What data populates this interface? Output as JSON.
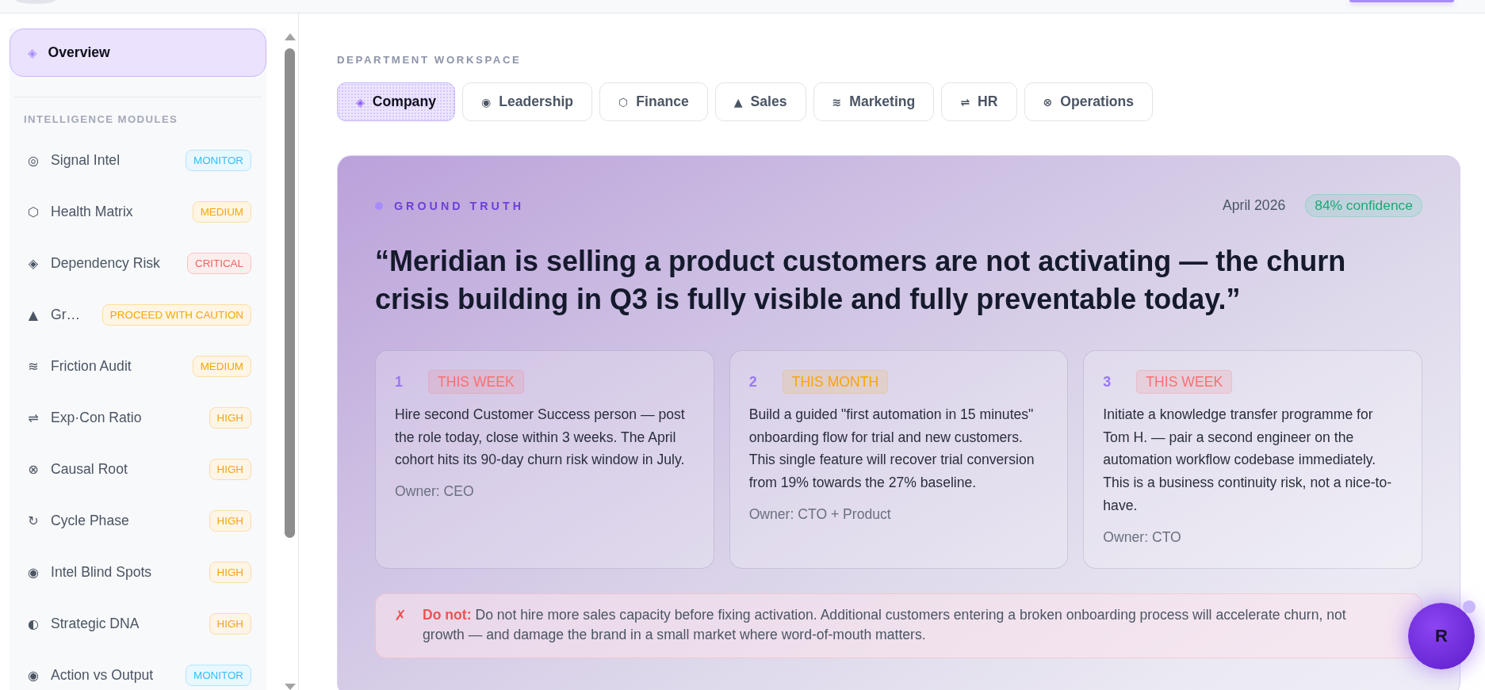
{
  "sidebar": {
    "overview": {
      "icon": "◈",
      "label": "Overview",
      "selected": true
    },
    "section_title": "INTELLIGENCE MODULES",
    "items": [
      {
        "icon": "◎",
        "label": "Signal Intel",
        "selected": false,
        "badge": {
          "text": "MONITOR",
          "color": "#38bdf8"
        }
      },
      {
        "icon": "⬡",
        "label": "Health Matrix",
        "selected": false,
        "badge": {
          "text": "MEDIUM",
          "color": "#f5a70b"
        }
      },
      {
        "icon": "◈",
        "label": "Dependency Risk",
        "selected": false,
        "badge": {
          "text": "CRITICAL",
          "color": "#ef6461"
        }
      },
      {
        "icon": "▲",
        "label": "Gr…",
        "selected": false,
        "badge": {
          "text": "PROCEED WITH CAUTION",
          "color": "#f5a70b"
        }
      },
      {
        "icon": "≋",
        "label": "Friction Audit",
        "selected": false,
        "badge": {
          "text": "MEDIUM",
          "color": "#f5a70b"
        }
      },
      {
        "icon": "⇌",
        "label": "Exp·Con Ratio",
        "selected": false,
        "badge": {
          "text": "HIGH",
          "color": "#f7a21b"
        }
      },
      {
        "icon": "⊗",
        "label": "Causal Root",
        "selected": false,
        "badge": {
          "text": "HIGH",
          "color": "#f7a21b"
        }
      },
      {
        "icon": "↻",
        "label": "Cycle Phase",
        "selected": false,
        "badge": {
          "text": "HIGH",
          "color": "#f7a21b"
        }
      },
      {
        "icon": "◉",
        "label": "Intel Blind Spots",
        "selected": false,
        "badge": {
          "text": "HIGH",
          "color": "#f7a21b"
        }
      },
      {
        "icon": "◐",
        "label": "Strategic DNA",
        "selected": false,
        "badge": {
          "text": "HIGH",
          "color": "#f7a21b"
        }
      },
      {
        "icon": "◉",
        "label": "Action vs Output",
        "selected": false,
        "badge": {
          "text": "MONITOR",
          "color": "#38bdf8"
        }
      }
    ]
  },
  "department_label": "DEPARTMENT WORKSPACE",
  "tabs": [
    {
      "icon": "◈",
      "label": "Company",
      "selected": true
    },
    {
      "icon": "◉",
      "label": "Leadership",
      "selected": false
    },
    {
      "icon": "⬡",
      "label": "Finance",
      "selected": false
    },
    {
      "icon": "▲",
      "label": "Sales",
      "selected": false
    },
    {
      "icon": "≋",
      "label": "Marketing",
      "selected": false
    },
    {
      "icon": "⇌",
      "label": "HR",
      "selected": false
    },
    {
      "icon": "⊗",
      "label": "Operations",
      "selected": false
    }
  ],
  "insight": {
    "label": "GROUND TRUTH",
    "date": "April 2026",
    "confidence": "84% confidence",
    "quote": "“Meridian is selling a product customers are not activating — the churn crisis building in Q3 is fully visible and fully preventable today.”",
    "actions": [
      {
        "number": "1",
        "timing": {
          "text": "THIS WEEK",
          "color": "#f87171"
        },
        "text": "Hire second Customer Success person — post the role today, close within 3 weeks. The April cohort hits its 90-day churn risk window in July.",
        "owner": "Owner: CEO"
      },
      {
        "number": "2",
        "timing": {
          "text": "THIS MONTH",
          "color": "#f5a70b"
        },
        "text": "Build a guided \"first automation in 15 minutes\" onboarding flow for trial and new customers. This single feature will recover trial conversion from 19% towards the 27% baseline.",
        "owner": "Owner: CTO + Product"
      },
      {
        "number": "3",
        "timing": {
          "text": "THIS WEEK",
          "color": "#f87171"
        },
        "text": "Initiate a knowledge transfer programme for Tom H. — pair a second engineer on the automation workflow codebase immediately. This is a business continuity risk, not a nice-to-have.",
        "owner": "Owner: CTO"
      }
    ],
    "warning": {
      "icon": "✗",
      "text": "**Do not:** Do not hire more sales capacity before fixing activation. Additional customers entering a broken onboarding process will accelerate churn, not growth — and damage the brand in a small market where word-of-mouth matters."
    }
  },
  "assistant": {
    "label": "R"
  }
}
